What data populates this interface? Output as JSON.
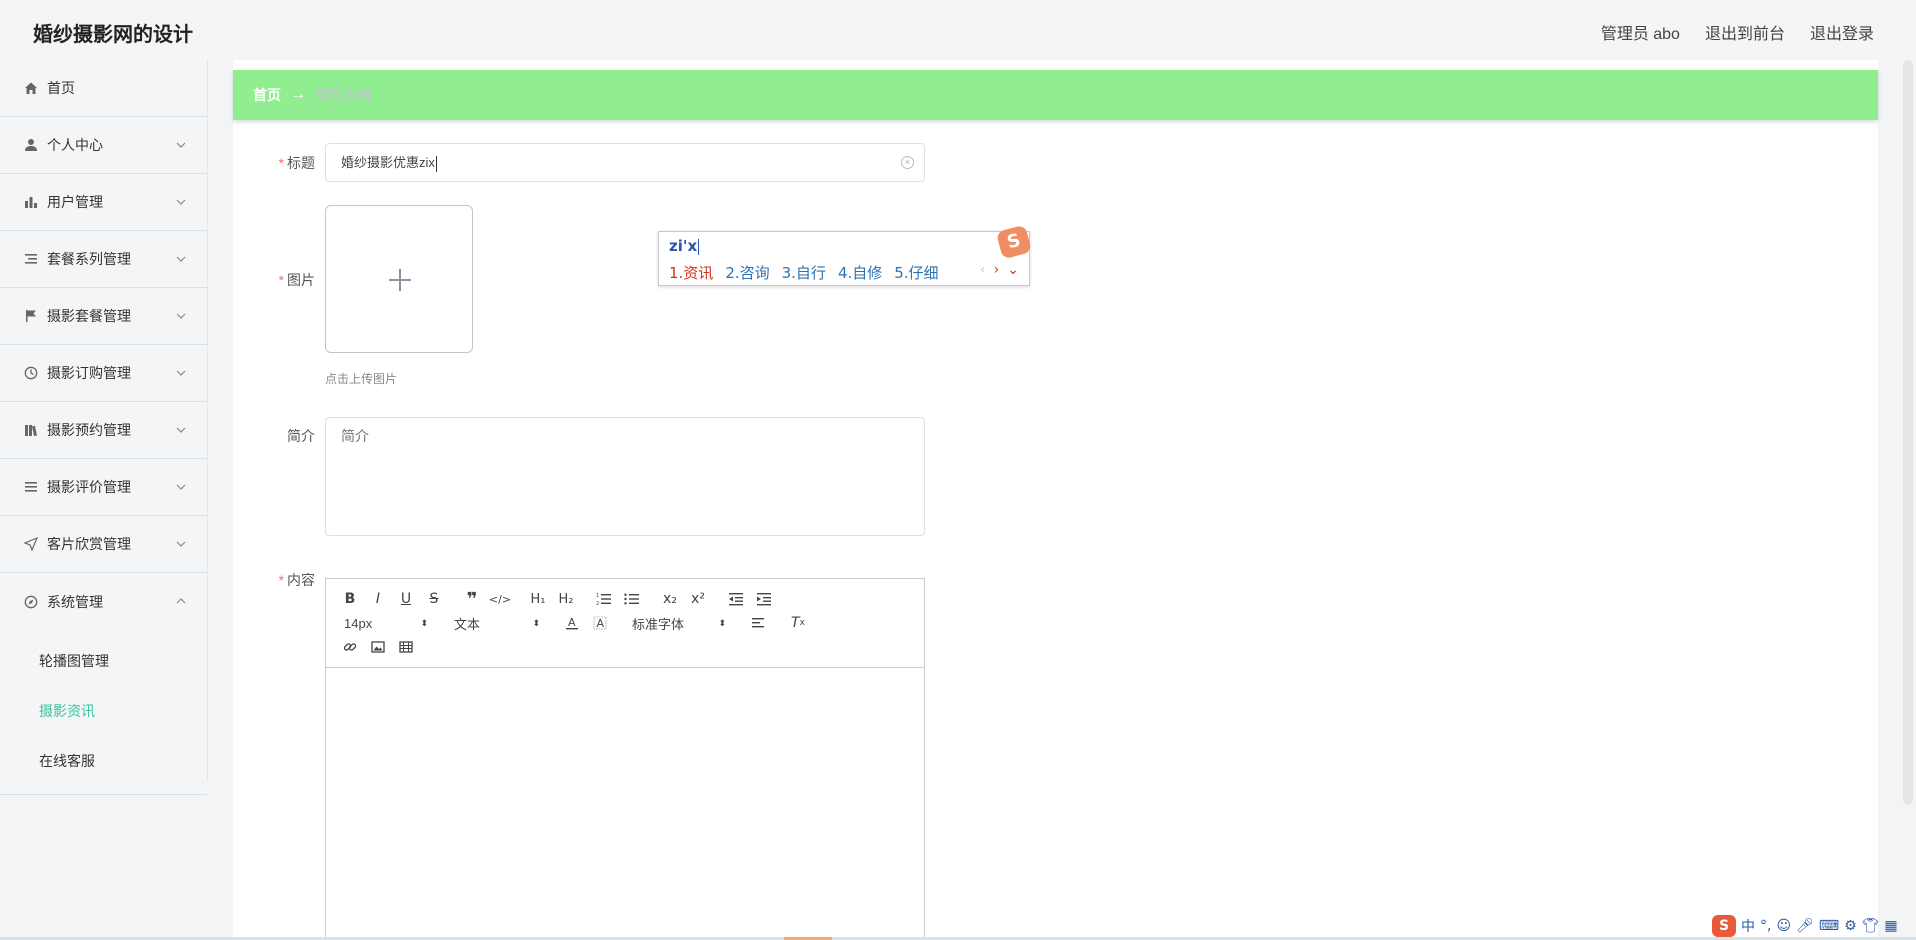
{
  "app": {
    "title": "婚纱摄影网的设计"
  },
  "header": {
    "user_label": "管理员 abo",
    "to_front_label": "退出到前台",
    "logout_label": "退出登录"
  },
  "sidebar": {
    "items": [
      {
        "label": "首页",
        "icon": "home-icon"
      },
      {
        "label": "个人中心",
        "icon": "user-icon"
      },
      {
        "label": "用户管理",
        "icon": "bar-chart-icon"
      },
      {
        "label": "套餐系列管理",
        "icon": "list-icon"
      },
      {
        "label": "摄影套餐管理",
        "icon": "flag-icon"
      },
      {
        "label": "摄影订购管理",
        "icon": "clock-icon"
      },
      {
        "label": "摄影预约管理",
        "icon": "library-icon"
      },
      {
        "label": "摄影评价管理",
        "icon": "menu-icon"
      },
      {
        "label": "客片欣赏管理",
        "icon": "send-icon"
      },
      {
        "label": "系统管理",
        "icon": "compass-icon"
      }
    ],
    "sub_items": [
      {
        "label": "轮播图管理"
      },
      {
        "label": "摄影资讯"
      },
      {
        "label": "在线客服"
      }
    ]
  },
  "breadcrumb": {
    "home": "首页",
    "separator": "→",
    "current": "摄影资讯"
  },
  "form": {
    "title_label": "标题",
    "title_value": "婚纱摄影优惠zix",
    "image_label": "图片",
    "upload_tip": "点击上传图片",
    "intro_label": "简介",
    "intro_placeholder": "简介",
    "content_label": "内容"
  },
  "editor": {
    "size_value": "14px",
    "text_value": "文本",
    "font_value": "标准字体"
  },
  "ime": {
    "composition": "zi'x",
    "candidates": [
      "1.资讯",
      "2.咨询",
      "3.自行",
      "4.自修",
      "5.仔细"
    ]
  },
  "tray": {
    "mode": "中"
  },
  "colors": {
    "breadcrumb_bg": "#90ee90",
    "active_menu": "#3cc3a3",
    "required": "#f56c6c"
  }
}
